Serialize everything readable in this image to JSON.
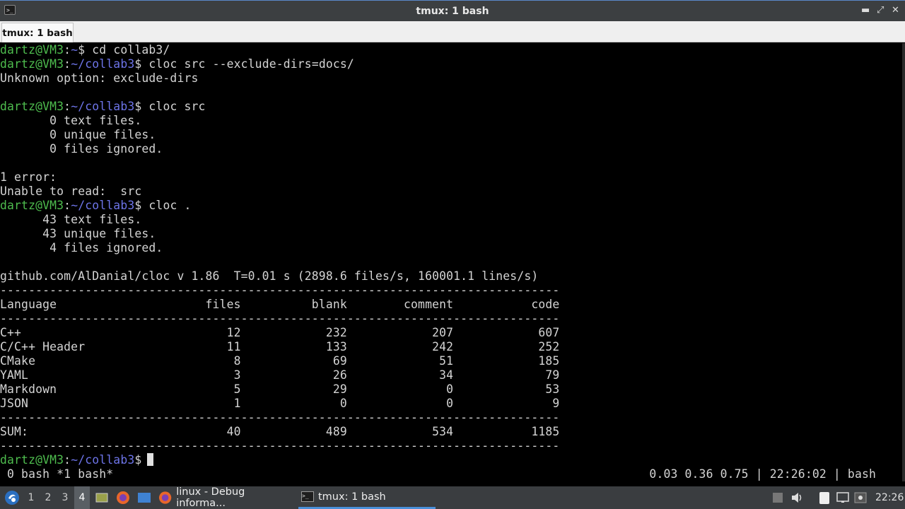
{
  "window": {
    "title": "tmux: 1 bash",
    "app_icon": "terminal-icon",
    "controls": {
      "minimize": "▬",
      "restore": "⤢",
      "close": "✕"
    }
  },
  "tabs": [
    {
      "label": "tmux: 1 bash"
    }
  ],
  "terminal": {
    "lines": [
      {
        "user": "dartz@VM3",
        "path": "~",
        "cmd": "$ cd collab3/"
      },
      {
        "user": "dartz@VM3",
        "path": "~/collab3",
        "cmd": "$ cloc src --exclude-dirs=docs/"
      },
      {
        "text": "Unknown option: exclude-dirs"
      },
      {
        "text": ""
      },
      {
        "user": "dartz@VM3",
        "path": "~/collab3",
        "cmd": "$ cloc src"
      },
      {
        "text": "       0 text files."
      },
      {
        "text": "       0 unique files."
      },
      {
        "text": "       0 files ignored."
      },
      {
        "text": ""
      },
      {
        "text": "1 error:"
      },
      {
        "text": "Unable to read:  src"
      },
      {
        "user": "dartz@VM3",
        "path": "~/collab3",
        "cmd": "$ cloc ."
      },
      {
        "text": "      43 text files."
      },
      {
        "text": "      43 unique files."
      },
      {
        "text": "       4 files ignored."
      },
      {
        "text": ""
      },
      {
        "text": "github.com/AlDanial/cloc v 1.86  T=0.01 s (2898.6 files/s, 160001.1 lines/s)"
      },
      {
        "text": "-------------------------------------------------------------------------------"
      },
      {
        "text": "Language                     files          blank        comment           code"
      },
      {
        "text": "-------------------------------------------------------------------------------"
      },
      {
        "text": "C++                             12            232            207            607"
      },
      {
        "text": "C/C++ Header                    11            133            242            252"
      },
      {
        "text": "CMake                            8             69             51            185"
      },
      {
        "text": "YAML                             3             26             34             79"
      },
      {
        "text": "Markdown                         5             29              0             53"
      },
      {
        "text": "JSON                             1              0              0              9"
      },
      {
        "text": "-------------------------------------------------------------------------------"
      },
      {
        "text": "SUM:                            40            489            534           1185"
      },
      {
        "text": "-------------------------------------------------------------------------------"
      },
      {
        "user": "dartz@VM3",
        "path": "~/collab3",
        "cmd": "$",
        "cursor": true
      }
    ],
    "status_left": " 0 bash *1 bash*",
    "status_right": "0.03 0.36 0.75 | 22:26:02 | bash"
  },
  "taskbar": {
    "workspaces": [
      "1",
      "2",
      "3",
      "4"
    ],
    "active_workspace": "4",
    "tasks": [
      {
        "label": "linux - Debug informa...",
        "icon": "firefox-icon"
      },
      {
        "label": "tmux: 1 bash",
        "icon": "terminal-icon"
      }
    ],
    "clock": "22:26"
  },
  "colors": {
    "prompt_user": "#4ebd4e",
    "prompt_path": "#6d74e8",
    "terminal_bg": "#000000"
  }
}
